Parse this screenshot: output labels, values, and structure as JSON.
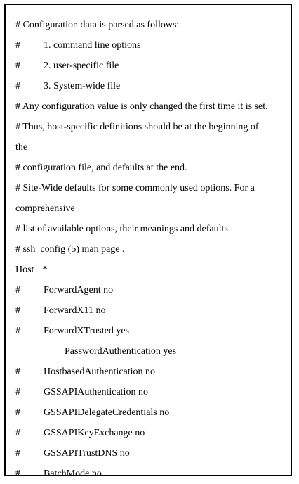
{
  "lines": [
    {
      "hash": "",
      "text": "# Configuration data is parsed as follows:",
      "indent": "none"
    },
    {
      "hash": "#",
      "text": "1. command line options",
      "indent": "indent1"
    },
    {
      "hash": "#",
      "text": "2. user-specific file",
      "indent": "indent1"
    },
    {
      "hash": "#",
      "text": "3. System-wide file",
      "indent": "indent1"
    },
    {
      "hash": "",
      "text": "# Any configuration value is only changed the first time it is set.",
      "indent": "none"
    },
    {
      "hash": "",
      "text": "# Thus, host-specific definitions should be at the beginning of",
      "indent": "none"
    },
    {
      "hash": "",
      "text": "the",
      "indent": "none"
    },
    {
      "hash": "",
      "text": "# configuration file, and defaults at the end.",
      "indent": "none"
    },
    {
      "hash": "",
      "text": "# Site-Wide defaults for some commonly used options. For a",
      "indent": "none"
    },
    {
      "hash": "",
      "text": "comprehensive",
      "indent": "none"
    },
    {
      "hash": "",
      "text": "# list of available options, their meanings and defaults",
      "indent": "none"
    },
    {
      "hash": "",
      "text": "# ssh_config (5) man page .",
      "indent": "none"
    }
  ],
  "host_line": {
    "keyword": "Host",
    "value": "*"
  },
  "option_lines": [
    {
      "hash": "#",
      "text": "ForwardAgent no",
      "indent": "indent3"
    },
    {
      "hash": "#",
      "text": "ForwardX11 no",
      "indent": "indent3"
    },
    {
      "hash": "#",
      "text": "ForwardXTrusted yes",
      "indent": "indent3"
    },
    {
      "hash": "",
      "text": "PasswordAuthentication yes",
      "indent": "indent2"
    },
    {
      "hash": "#",
      "text": "HostbasedAuthentication no",
      "indent": "indent3"
    },
    {
      "hash": "#",
      "text": "GSSAPIAuthentication no",
      "indent": "indent3"
    },
    {
      "hash": "#",
      "text": "GSSAPIDelegateCredentials no",
      "indent": "indent3"
    },
    {
      "hash": "#",
      "text": "GSSAPIKeyExchange no",
      "indent": "indent3"
    },
    {
      "hash": "#",
      "text": "GSSAPITrustDNS no",
      "indent": "indent3"
    },
    {
      "hash": "#",
      "text": "BatchMode no",
      "indent": "indent3"
    }
  ]
}
